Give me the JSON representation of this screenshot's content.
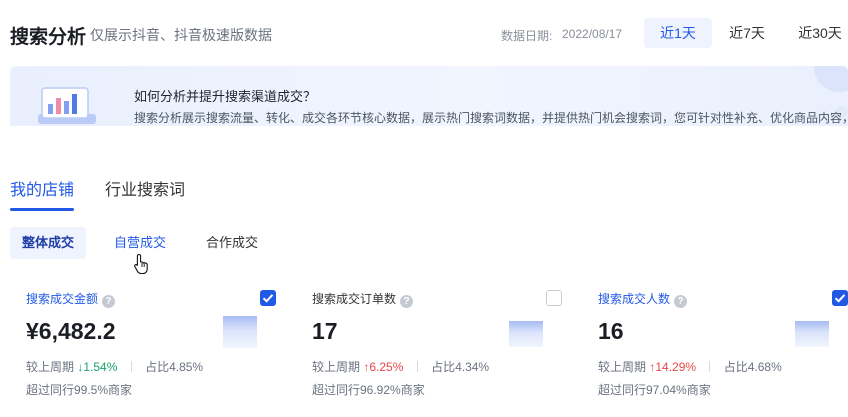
{
  "header": {
    "title": "搜索分析",
    "subtitle": "仅展示抖音、抖音极速版数据",
    "date_label": "数据日期:",
    "date_value": "2022/08/17",
    "ranges": [
      "近1天",
      "近7天",
      "近30天"
    ]
  },
  "banner": {
    "title": "如何分析并提升搜索渠道成交？",
    "description": "搜索分析展示搜索流量、转化、成交各环节核心数据，展示热门搜索词数据，并提供热门机会搜索词，您可针对性补充、优化商品内容，提"
  },
  "tabs": [
    "我的店铺",
    "行业搜索词"
  ],
  "subtabs": [
    "整体成交",
    "自营成交",
    "合作成交"
  ],
  "cards": [
    {
      "label": "搜索成交金额",
      "checked": true,
      "value": "¥6,482.2",
      "compare_label": "较上周期",
      "compare_arrow": "↓",
      "compare_value": "1.54%",
      "share": "占比4.85%",
      "exceed": "超过同行99.5%商家"
    },
    {
      "label": "搜索成交订单数",
      "checked": false,
      "value": "17",
      "compare_label": "较上周期",
      "compare_arrow": "↑",
      "compare_value": "6.25%",
      "share": "占比4.34%",
      "exceed": "超过同行96.92%商家"
    },
    {
      "label": "搜索成交人数",
      "checked": true,
      "value": "16",
      "compare_label": "较上周期",
      "compare_arrow": "↑",
      "compare_value": "14.29%",
      "share": "占比4.68%",
      "exceed": "超过同行97.04%商家"
    }
  ],
  "colors": {
    "accent": "#2158e6",
    "down": "#16a66b",
    "up": "#e5484d"
  }
}
